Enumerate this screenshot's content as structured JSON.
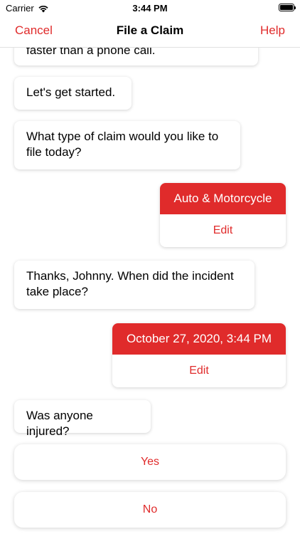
{
  "status_bar": {
    "carrier": "Carrier",
    "time": "3:44 PM"
  },
  "nav": {
    "cancel_label": "Cancel",
    "title": "File a Claim",
    "help_label": "Help"
  },
  "messages": [
    {
      "from": "bot",
      "text": "faster than a phone call."
    },
    {
      "from": "bot",
      "text": "Let's get started."
    },
    {
      "from": "bot",
      "text": "What type of claim would you like to file today?"
    },
    {
      "from": "user",
      "text": "Auto & Motorcycle",
      "edit_label": "Edit"
    },
    {
      "from": "bot",
      "text": "Thanks, Johnny. When did the incident take place?"
    },
    {
      "from": "user",
      "text": "October 27, 2020, 3:44 PM",
      "edit_label": "Edit"
    },
    {
      "from": "bot",
      "text": "Was anyone injured?"
    }
  ],
  "options": [
    {
      "label": "Yes"
    },
    {
      "label": "No"
    }
  ],
  "colors": {
    "accent": "#e02b2b",
    "background": "#ffffff"
  }
}
